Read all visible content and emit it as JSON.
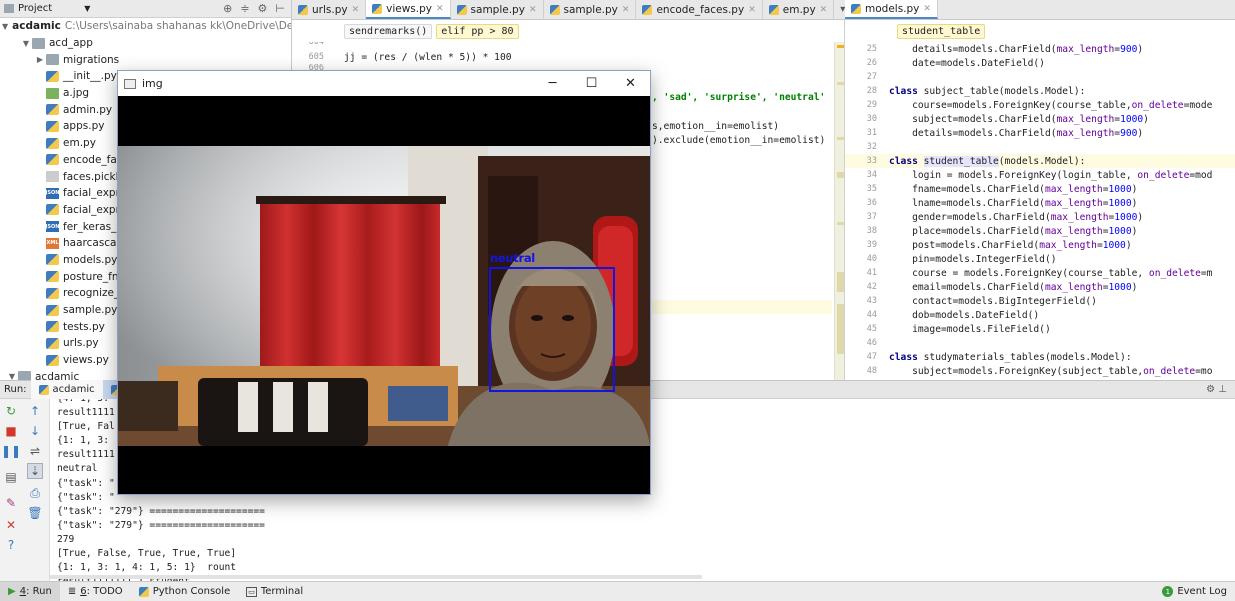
{
  "project_panel": {
    "title": "Project",
    "root_name": "acdamic",
    "root_path": "C:\\Users\\sainaba shahanas kk\\OneDrive\\Desktop",
    "items": [
      {
        "label": "acd_app",
        "kind": "folder",
        "arrow": "▼"
      },
      {
        "label": "migrations",
        "kind": "folder",
        "arrow": "▶"
      },
      {
        "label": "__init__.py",
        "kind": "py",
        "arrow": ""
      },
      {
        "label": "a.jpg",
        "kind": "img",
        "arrow": ""
      },
      {
        "label": "admin.py",
        "kind": "py",
        "arrow": ""
      },
      {
        "label": "apps.py",
        "kind": "py",
        "arrow": ""
      },
      {
        "label": "em.py",
        "kind": "py",
        "arrow": ""
      },
      {
        "label": "encode_fac",
        "kind": "py",
        "arrow": ""
      },
      {
        "label": "faces.pickle",
        "kind": "file",
        "arrow": ""
      },
      {
        "label": "facial_expre",
        "kind": "json",
        "arrow": ""
      },
      {
        "label": "facial_expre",
        "kind": "py",
        "arrow": ""
      },
      {
        "label": "fer_keras_m",
        "kind": "json",
        "arrow": ""
      },
      {
        "label": "haarcascad",
        "kind": "xml",
        "arrow": ""
      },
      {
        "label": "models.py",
        "kind": "py",
        "arrow": ""
      },
      {
        "label": "posture_fn.",
        "kind": "py",
        "arrow": ""
      },
      {
        "label": "recognize_f",
        "kind": "py",
        "arrow": ""
      },
      {
        "label": "sample.py",
        "kind": "py",
        "arrow": ""
      },
      {
        "label": "tests.py",
        "kind": "py",
        "arrow": ""
      },
      {
        "label": "urls.py",
        "kind": "py",
        "arrow": ""
      },
      {
        "label": "views.py",
        "kind": "py",
        "arrow": ""
      },
      {
        "label": "acdamic",
        "kind": "folder",
        "arrow": "▼"
      }
    ]
  },
  "editor_tabs_left": [
    {
      "label": "urls.py",
      "active": false
    },
    {
      "label": "views.py",
      "active": true
    },
    {
      "label": "sample.py",
      "active": false
    },
    {
      "label": "sample.py",
      "active": false
    },
    {
      "label": "encode_faces.py",
      "active": false
    },
    {
      "label": "em.py",
      "active": false
    }
  ],
  "editor_tabs_right": [
    {
      "label": "models.py",
      "active": true
    }
  ],
  "left_editor": {
    "breadcrumbs": [
      "sendremarks()",
      "elif pp > 80"
    ],
    "line_605": "jj = (res / (wlen * 5)) * 100",
    "emotions_fragment": ", 'sad', 'surprise', 'neutral'",
    "filter_fragment": "s,emotion__in=emolist)",
    "exclude_fragment": ").exclude(emotion__in=emolist)"
  },
  "right_editor": {
    "breadcrumb": "student_table",
    "lines": [
      {
        "n": 25,
        "text": "    details=models.CharField(max_length=900)"
      },
      {
        "n": 26,
        "text": "    date=models.DateField()"
      },
      {
        "n": 27,
        "text": ""
      },
      {
        "n": 28,
        "text": "class subject_table(models.Model):"
      },
      {
        "n": 29,
        "text": "    course=models.ForeignKey(course_table,on_delete=mode"
      },
      {
        "n": 30,
        "text": "    subject=models.CharField(max_length=1000)"
      },
      {
        "n": 31,
        "text": "    details=models.CharField(max_length=900)"
      },
      {
        "n": 32,
        "text": ""
      },
      {
        "n": 33,
        "text": "class student_table(models.Model):"
      },
      {
        "n": 34,
        "text": "    login = models.ForeignKey(login_table, on_delete=mod"
      },
      {
        "n": 35,
        "text": "    fname=models.CharField(max_length=1000)"
      },
      {
        "n": 36,
        "text": "    lname=models.CharField(max_length=1000)"
      },
      {
        "n": 37,
        "text": "    gender=models.CharField(max_length=1000)"
      },
      {
        "n": 38,
        "text": "    place=models.CharField(max_length=1000)"
      },
      {
        "n": 39,
        "text": "    post=models.CharField(max_length=1000)"
      },
      {
        "n": 40,
        "text": "    pin=models.IntegerField()"
      },
      {
        "n": 41,
        "text": "    course = models.ForeignKey(course_table, on_delete=m"
      },
      {
        "n": 42,
        "text": "    email=models.CharField(max_length=1000)"
      },
      {
        "n": 43,
        "text": "    contact=models.BigIntegerField()"
      },
      {
        "n": 44,
        "text": "    dob=models.DateField()"
      },
      {
        "n": 45,
        "text": "    image=models.FileField()"
      },
      {
        "n": 46,
        "text": ""
      },
      {
        "n": 47,
        "text": "class studymaterials_tables(models.Model):"
      },
      {
        "n": 48,
        "text": "    subject=models.ForeignKey(subject_table,on_delete=mo"
      }
    ]
  },
  "run_panel": {
    "label": "Run:",
    "tabs": [
      "acdamic",
      "em"
    ],
    "console_lines": [
      "{4: 1, 5: ",
      "result1111",
      "[True, Fal",
      "{1: 1, 3: ",
      "result1111",
      "neutral",
      "{\"task\": \"",
      "{\"task\": \"",
      "{\"task\": \"279\"} ====================",
      "{\"task\": \"279\"} ====================",
      "279",
      "[True, False, True, True, True]",
      "{1: 1, 3: 1, 4: 1, 5: 1}  rount",
      "result1111111 1 student"
    ]
  },
  "status_bar": {
    "items": [
      {
        "key": "4",
        "label": ": Run",
        "active": true
      },
      {
        "key": "6",
        "label": ": TODO",
        "active": false
      },
      {
        "key": "",
        "label": "Python Console",
        "active": false
      },
      {
        "key": "",
        "label": "Terminal",
        "active": false
      }
    ],
    "event_log": "Event Log"
  },
  "image_window": {
    "title": "img",
    "detection_label": "neutral",
    "box_color": "#1414e0"
  }
}
